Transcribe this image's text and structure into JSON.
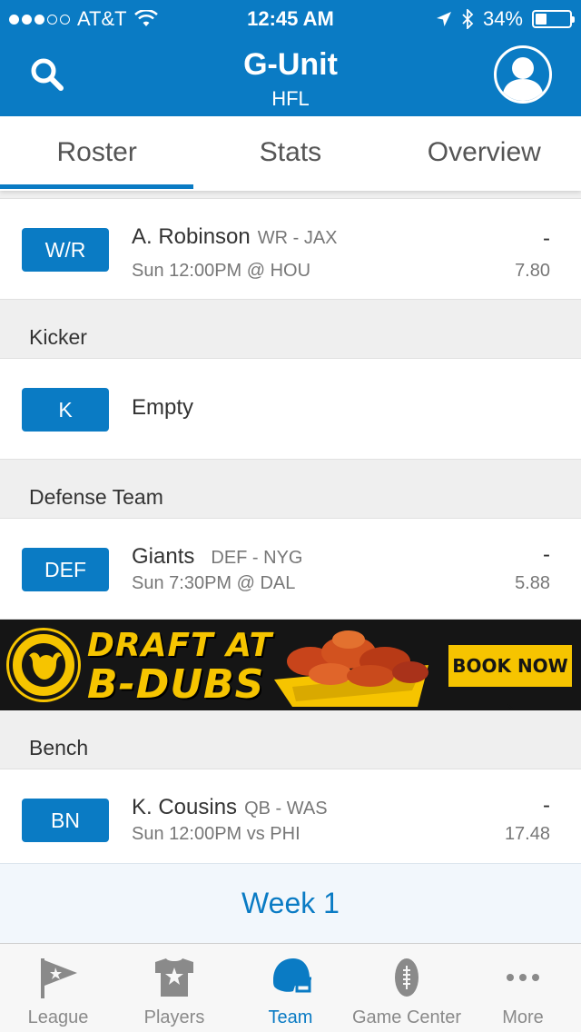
{
  "status_bar": {
    "carrier": "AT&T",
    "time": "12:45 AM",
    "battery": "34%",
    "battery_level": 0.34,
    "signal_bars": 3,
    "signal_total": 5
  },
  "header": {
    "title": "G-Unit",
    "subtitle": "HFL"
  },
  "tabs": [
    {
      "label": "Roster",
      "active": true
    },
    {
      "label": "Stats",
      "active": false
    },
    {
      "label": "Overview",
      "active": false
    }
  ],
  "roster": {
    "wr_row": {
      "badge": "W/R",
      "name": "A. Robinson",
      "pos": "WR - JAX",
      "game": "Sun 12:00PM @ HOU",
      "proj_dash": "-",
      "proj": "7.80"
    },
    "kicker_section": "Kicker",
    "kicker_row": {
      "badge": "K",
      "name": "Empty"
    },
    "defense_section": "Defense Team",
    "def_row": {
      "badge": "DEF",
      "name": "Giants",
      "pos": "DEF - NYG",
      "game": "Sun 7:30PM @ DAL",
      "proj_dash": "-",
      "proj": "5.88"
    },
    "bench_section": "Bench",
    "bench_row": {
      "badge": "BN",
      "name": "K. Cousins",
      "pos": "QB - WAS",
      "game": "Sun 12:00PM vs PHI",
      "proj_dash": "-",
      "proj": "17.48"
    }
  },
  "ad": {
    "line1": "DRAFT AT",
    "line2": "B-DUBS",
    "cta": "BOOK NOW ›",
    "brand_color": "#f6c400"
  },
  "week": "Week 1",
  "bottom_nav": [
    {
      "label": "League",
      "icon": "flag-icon",
      "active": false
    },
    {
      "label": "Players",
      "icon": "jersey-icon",
      "active": false
    },
    {
      "label": "Team",
      "icon": "helmet-icon",
      "active": true
    },
    {
      "label": "Game Center",
      "icon": "football-icon",
      "active": false
    },
    {
      "label": "More",
      "icon": "more-icon",
      "active": false
    }
  ],
  "colors": {
    "accent": "#0a7bc4",
    "section_bg": "#efefef",
    "muted_text": "#777777"
  }
}
